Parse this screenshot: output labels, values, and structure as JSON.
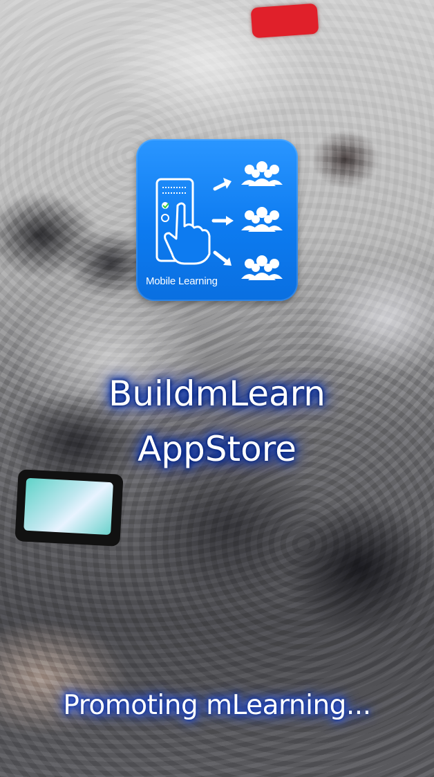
{
  "splash": {
    "app_icon": {
      "icon": "mobile-learning-icon",
      "caption": "Mobile Learning",
      "color": "#1185f8"
    },
    "title_line_1": "BuildmLearn",
    "title_line_2": "AppStore",
    "tagline": "Promoting mLearning...",
    "glow_color": "#0033b8"
  }
}
